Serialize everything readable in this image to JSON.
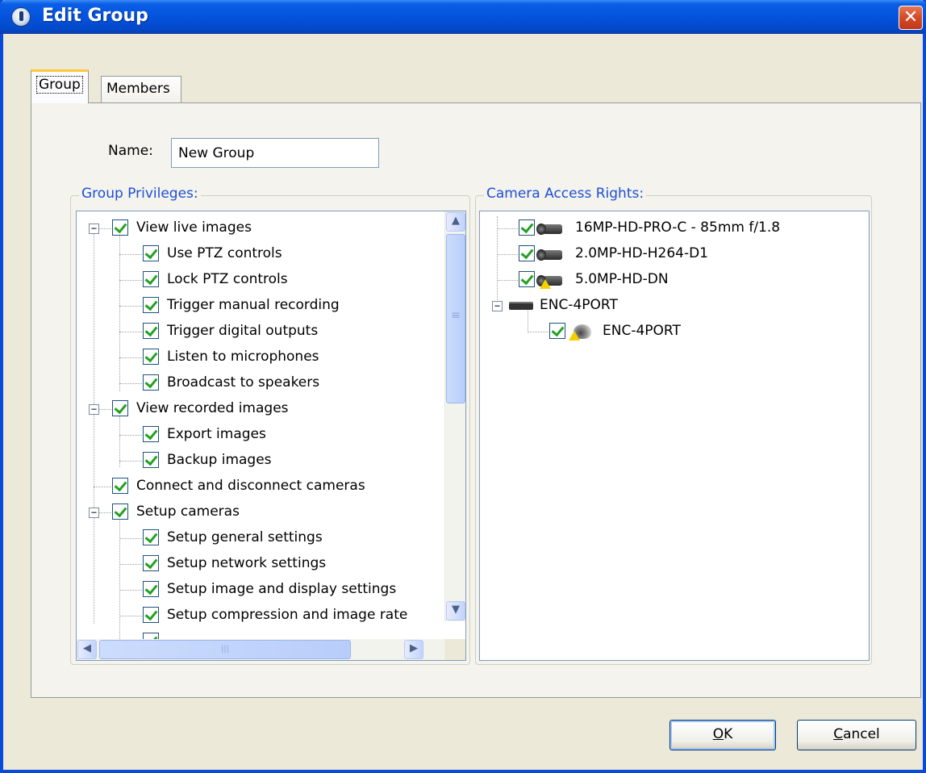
{
  "window": {
    "title": "Edit Group",
    "close_glyph": "✕"
  },
  "tabs": [
    {
      "label": "Group"
    },
    {
      "label": "Members"
    }
  ],
  "name_field": {
    "label": "Name:",
    "value": "New Group"
  },
  "privileges": {
    "legend": "Group Privileges:",
    "items": [
      {
        "label": "View live images",
        "level": 0,
        "expander": "−"
      },
      {
        "label": "Use PTZ controls",
        "level": 1
      },
      {
        "label": "Lock PTZ controls",
        "level": 1
      },
      {
        "label": "Trigger manual recording",
        "level": 1
      },
      {
        "label": "Trigger digital outputs",
        "level": 1
      },
      {
        "label": "Listen to microphones",
        "level": 1
      },
      {
        "label": "Broadcast to speakers",
        "level": 1
      },
      {
        "label": "View recorded images",
        "level": 0,
        "expander": "−"
      },
      {
        "label": "Export images",
        "level": 1
      },
      {
        "label": "Backup images",
        "level": 1
      },
      {
        "label": "Connect and disconnect cameras",
        "level": 0
      },
      {
        "label": "Setup cameras",
        "level": 0,
        "expander": "−"
      },
      {
        "label": "Setup general settings",
        "level": 1
      },
      {
        "label": "Setup network settings",
        "level": 1
      },
      {
        "label": "Setup image and display settings",
        "level": 1
      },
      {
        "label": "Setup compression and image rate",
        "level": 1
      }
    ],
    "scroll": {
      "up": "▲",
      "down": "▼",
      "left": "◀",
      "right": "▶",
      "grip": "≡",
      "hgrip": "|||"
    }
  },
  "camera_access": {
    "legend": "Camera Access Rights:",
    "items": [
      {
        "label": "16MP-HD-PRO-C - 85mm f/1.8",
        "icon": "camera-icon"
      },
      {
        "label": "2.0MP-HD-H264-D1",
        "icon": "camera-icon"
      },
      {
        "label": "5.0MP-HD-DN",
        "icon": "camera-warning-icon"
      },
      {
        "label": "ENC-4PORT",
        "icon": "encoder-icon"
      },
      {
        "label": "ENC-4PORT",
        "icon": "dome-camera-warning-icon"
      }
    ]
  },
  "buttons": {
    "ok": {
      "mnemonic": "O",
      "rest": "K"
    },
    "cancel": {
      "mnemonic": "C",
      "rest": "ancel"
    }
  }
}
